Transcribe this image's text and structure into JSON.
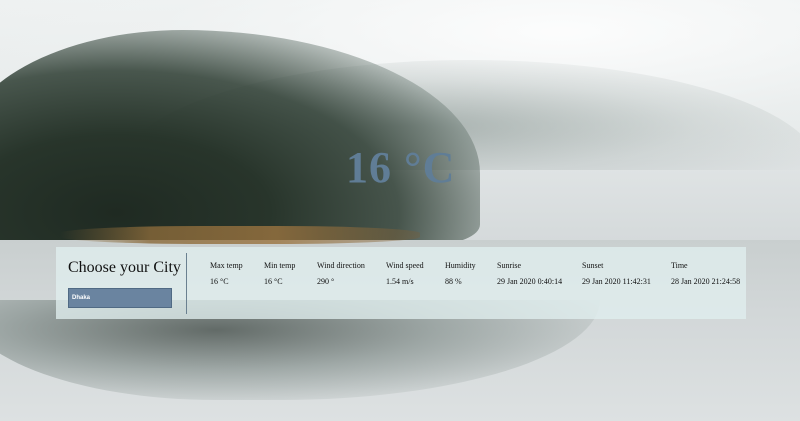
{
  "temperature": "16 °C",
  "panel": {
    "title": "Choose your City",
    "city_select": {
      "value": "Dhaka"
    }
  },
  "stats": [
    {
      "label": "Max temp",
      "value": "16 °C"
    },
    {
      "label": "Min temp",
      "value": "16 °C"
    },
    {
      "label": "Wind direction",
      "value": "290 °"
    },
    {
      "label": "Wind speed",
      "value": "1.54 m/s"
    },
    {
      "label": "Humidity",
      "value": "88 %"
    },
    {
      "label": "Sunrise",
      "value": "29 Jan 2020 0:40:14"
    },
    {
      "label": "Sunset",
      "value": "29 Jan 2020 11:42:31"
    },
    {
      "label": "Time",
      "value": "28 Jan 2020 21:24:58"
    }
  ],
  "colors": {
    "temperature_text": "#607d96",
    "select_bg": "#6a84a0",
    "panel_bg": "#e0eeee"
  }
}
